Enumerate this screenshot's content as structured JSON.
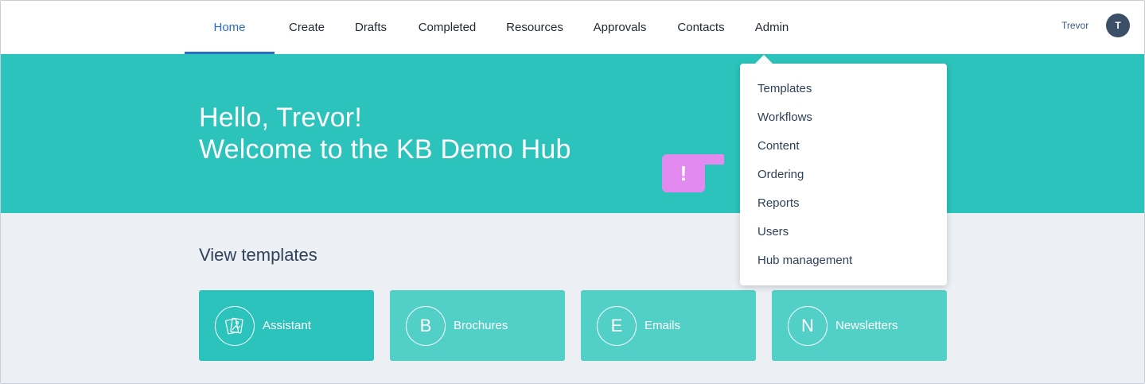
{
  "nav": {
    "items": [
      {
        "label": "Home",
        "active": true
      },
      {
        "label": "Create"
      },
      {
        "label": "Drafts"
      },
      {
        "label": "Completed"
      },
      {
        "label": "Resources"
      },
      {
        "label": "Approvals"
      },
      {
        "label": "Contacts"
      },
      {
        "label": "Admin"
      }
    ],
    "user_name": "Trevor",
    "avatar_initial": "T"
  },
  "hero": {
    "line1": "Hello, Trevor!",
    "line2": "Welcome to the KB Demo Hub"
  },
  "marker": {
    "text": "!"
  },
  "section": {
    "title": "View templates",
    "cards": [
      {
        "icon": "image-stack-icon",
        "label": "Assistant"
      },
      {
        "letter": "B",
        "label": "Brochures"
      },
      {
        "letter": "E",
        "label": "Emails"
      },
      {
        "letter": "N",
        "label": "Newsletters"
      }
    ]
  },
  "admin_menu": {
    "items": [
      "Templates",
      "Workflows",
      "Content",
      "Ordering",
      "Reports",
      "Users",
      "Hub management"
    ]
  },
  "colors": {
    "accent": "#2b6cc4",
    "teal": "#2bc3bb",
    "teal_light": "#52d0c7",
    "marker": "#e38af0",
    "avatar": "#3b4f66"
  }
}
